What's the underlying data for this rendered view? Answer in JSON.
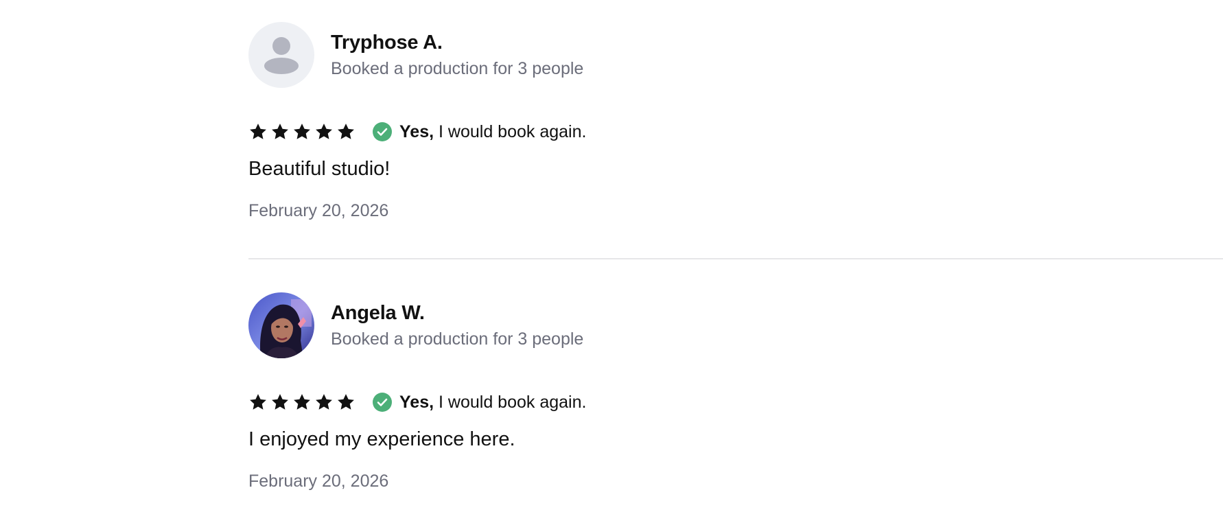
{
  "reviews": [
    {
      "name": "Tryphose A.",
      "booking": "Booked a production for 3 people",
      "avatar": "placeholder-person-icon",
      "rating": 5,
      "rating_max": 5,
      "rebook_yes": "Yes,",
      "rebook_rest": " I would book again.",
      "text": "Beautiful studio!",
      "date": "February 20, 2026"
    },
    {
      "name": "Angela W.",
      "booking": "Booked a production for 3 people",
      "avatar": "profile-photo",
      "rating": 5,
      "rating_max": 5,
      "rebook_yes": "Yes,",
      "rebook_rest": " I would book again.",
      "text": "I enjoyed my experience here.",
      "date": "February 20, 2026"
    }
  ],
  "colors": {
    "check_green": "#4caf78",
    "muted_text": "#6b6d7a",
    "divider": "#e6e6e8",
    "avatar_bg": "#eef0f4",
    "avatar_icon": "#b3b5c0"
  }
}
